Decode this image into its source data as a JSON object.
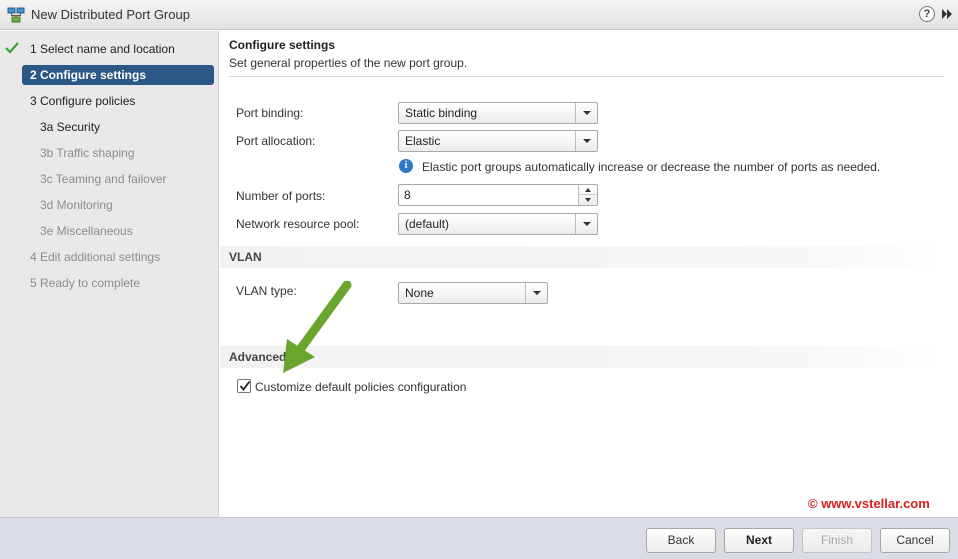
{
  "window": {
    "title": "New Distributed Port Group",
    "help_glyph": "?"
  },
  "steps": [
    {
      "label": "1  Select name and location",
      "state": "done"
    },
    {
      "label": "2  Configure settings",
      "state": "active"
    },
    {
      "label": "3  Configure policies",
      "state": "normal"
    },
    {
      "label": "3a  Security",
      "state": "normal"
    },
    {
      "label": "3b  Traffic shaping",
      "state": "disabled"
    },
    {
      "label": "3c  Teaming and failover",
      "state": "disabled"
    },
    {
      "label": "3d  Monitoring",
      "state": "disabled"
    },
    {
      "label": "3e  Miscellaneous",
      "state": "disabled"
    },
    {
      "label": "4  Edit additional settings",
      "state": "disabled"
    },
    {
      "label": "5  Ready to complete",
      "state": "disabled"
    }
  ],
  "header": {
    "title": "Configure settings",
    "subtitle": "Set general properties of the new port group."
  },
  "form": {
    "port_binding": {
      "label": "Port binding:",
      "value": "Static binding"
    },
    "port_allocation": {
      "label": "Port allocation:",
      "value": "Elastic"
    },
    "info": {
      "glyph": "i",
      "text": "Elastic port groups automatically increase or decrease the number of ports as needed."
    },
    "num_ports": {
      "label": "Number of ports:",
      "value": "8"
    },
    "resource_pool": {
      "label": "Network resource pool:",
      "value": "(default)"
    }
  },
  "vlan": {
    "section": "VLAN",
    "type_label": "VLAN type:",
    "type_value": "None"
  },
  "advanced": {
    "section": "Advanced",
    "customize_label": "Customize default policies configuration",
    "customize_checked": true
  },
  "watermark": "© www.vstellar.com",
  "footer": {
    "back": "Back",
    "next": "Next",
    "finish": "Finish",
    "cancel": "Cancel"
  },
  "colors": {
    "active_step": "#2b5887",
    "check": "#3aa33a",
    "info": "#2d7bc8",
    "arrow": "#6aa62e",
    "watermark": "#d61f1f"
  },
  "icons": {
    "app": "network-portgroup-icon",
    "help": "help-icon",
    "expand": "double-chevron-right-icon",
    "check": "checkmark-icon",
    "info": "info-icon"
  }
}
